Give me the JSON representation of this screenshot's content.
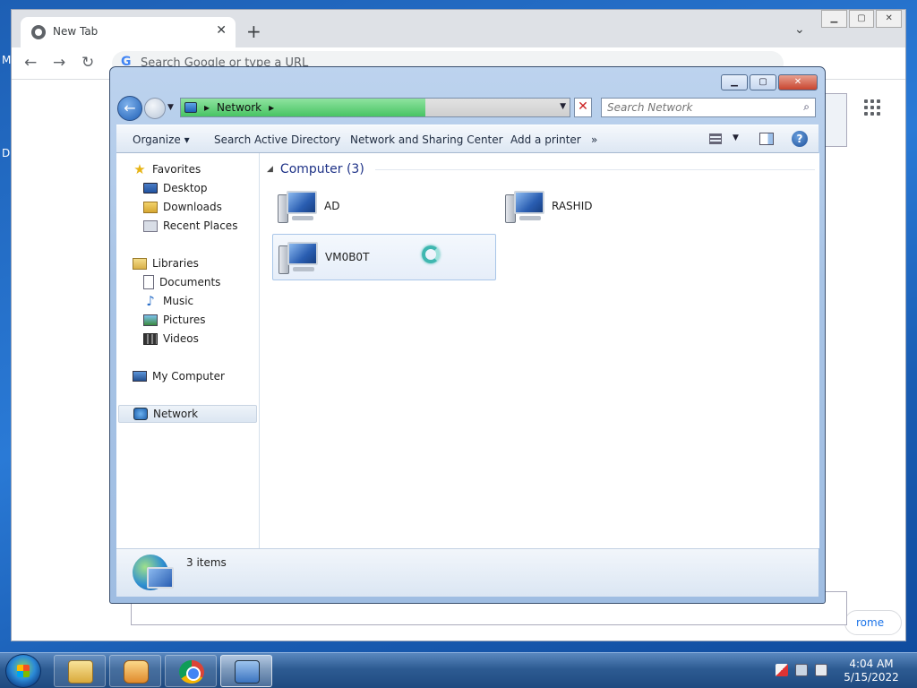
{
  "desktop": {
    "fragment_left_top": "M",
    "fragment_left_mid": "D"
  },
  "chrome": {
    "tab_title": "New Tab",
    "tab_close": "✕",
    "new_tab": "+",
    "tab_menu": "⌄",
    "omnibox_placeholder": "Search Google or type a URL",
    "google_g": "G",
    "customize_label": "rome"
  },
  "explorer": {
    "address": {
      "location": "Network",
      "sep": "▸"
    },
    "search_placeholder": "Search Network",
    "toolbar": {
      "organize": "Organize ▾",
      "search_ad": "Search Active Directory",
      "network_sharing": "Network and Sharing Center",
      "add_printer": "Add a printer",
      "more": "»",
      "help": "?"
    },
    "nav": {
      "favorites": "Favorites",
      "desktop": "Desktop",
      "downloads": "Downloads",
      "recent": "Recent Places",
      "libraries": "Libraries",
      "documents": "Documents",
      "music": "Music",
      "pictures": "Pictures",
      "videos": "Videos",
      "my_computer": "My Computer",
      "network": "Network"
    },
    "group": {
      "label": "Computer (3)",
      "toggle": "◢"
    },
    "items": [
      {
        "name": "AD"
      },
      {
        "name": "RASHID"
      },
      {
        "name": "VM0B0T"
      }
    ],
    "status": {
      "count": "3 items"
    }
  },
  "taskbar": {
    "time": "4:04 AM",
    "date": "5/15/2022"
  },
  "colors": {
    "accent": "#1e3287",
    "progress": "#48c463",
    "desktop": "#2a7ad6"
  },
  "address_progress": 0.63
}
